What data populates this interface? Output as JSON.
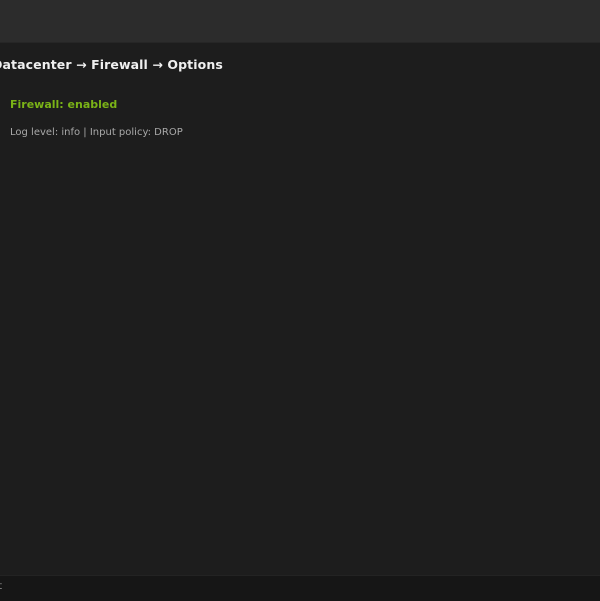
{
  "breadcrumb": {
    "text": "Datacenter → Firewall → Options"
  },
  "firewall": {
    "status_text": "Firewall: enabled",
    "status_color": "#7ab317",
    "details": "Log level: info | Input policy: DROP"
  },
  "footer": {
    "text": "rt"
  }
}
